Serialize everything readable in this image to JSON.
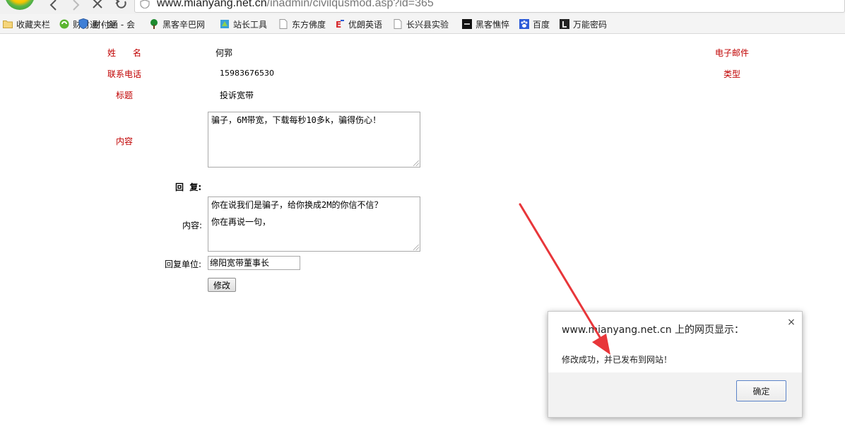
{
  "browser": {
    "url_host": "www.mianyang.net.cn",
    "url_path": "/inadmin/civilqusmod.asp?id=365"
  },
  "bookmarks": [
    {
      "label": "收藏夹栏",
      "icon": "folder-icon"
    },
    {
      "label": "财付通 - 会",
      "icon": "caifutong-icon"
    },
    {
      "label": "黑客辛巴网",
      "icon": "tree-icon"
    },
    {
      "label": "站长工具",
      "icon": "webmaster-icon"
    },
    {
      "label": "东方佛度",
      "icon": "page-icon"
    },
    {
      "label": "优朗英语",
      "icon": "english-icon"
    },
    {
      "label": "长兴县实验",
      "icon": "page-icon"
    },
    {
      "label": "黑客憔悴",
      "icon": "black-square-icon"
    },
    {
      "label": "百度",
      "icon": "paw-icon"
    },
    {
      "label": "万能密码",
      "icon": "l-icon"
    }
  ],
  "form": {
    "name_label": "姓　　名",
    "name_value": "何郛",
    "email_label": "电子邮件",
    "phone_label": "联系电话",
    "phone_value": "15983676530",
    "type_label": "类型",
    "title_label": "标题",
    "title_value": "投诉宽带",
    "content_label": "内容",
    "content_value": "骗子，6M带宽，下载每秒10多k，骗得伤心！",
    "reply_heading": "回  复:",
    "reply_content_label": "内容:",
    "reply_content_line1": "你在说我们是骗子，给你换成2M的你信不信？",
    "reply_content_line2": "你在再说一句，",
    "reply_unit_label": "回复单位:",
    "reply_unit_value": "绵阳宽带董事长",
    "submit_label": "修改"
  },
  "dialog": {
    "title": "www.mianyang.net.cn 上的网页显示：",
    "message": "修改成功，并已发布到网站！",
    "ok_label": "确定",
    "close_symbol": "×"
  },
  "colors": {
    "label_red": "#c00000",
    "annotation_arrow": "#e8363a"
  }
}
